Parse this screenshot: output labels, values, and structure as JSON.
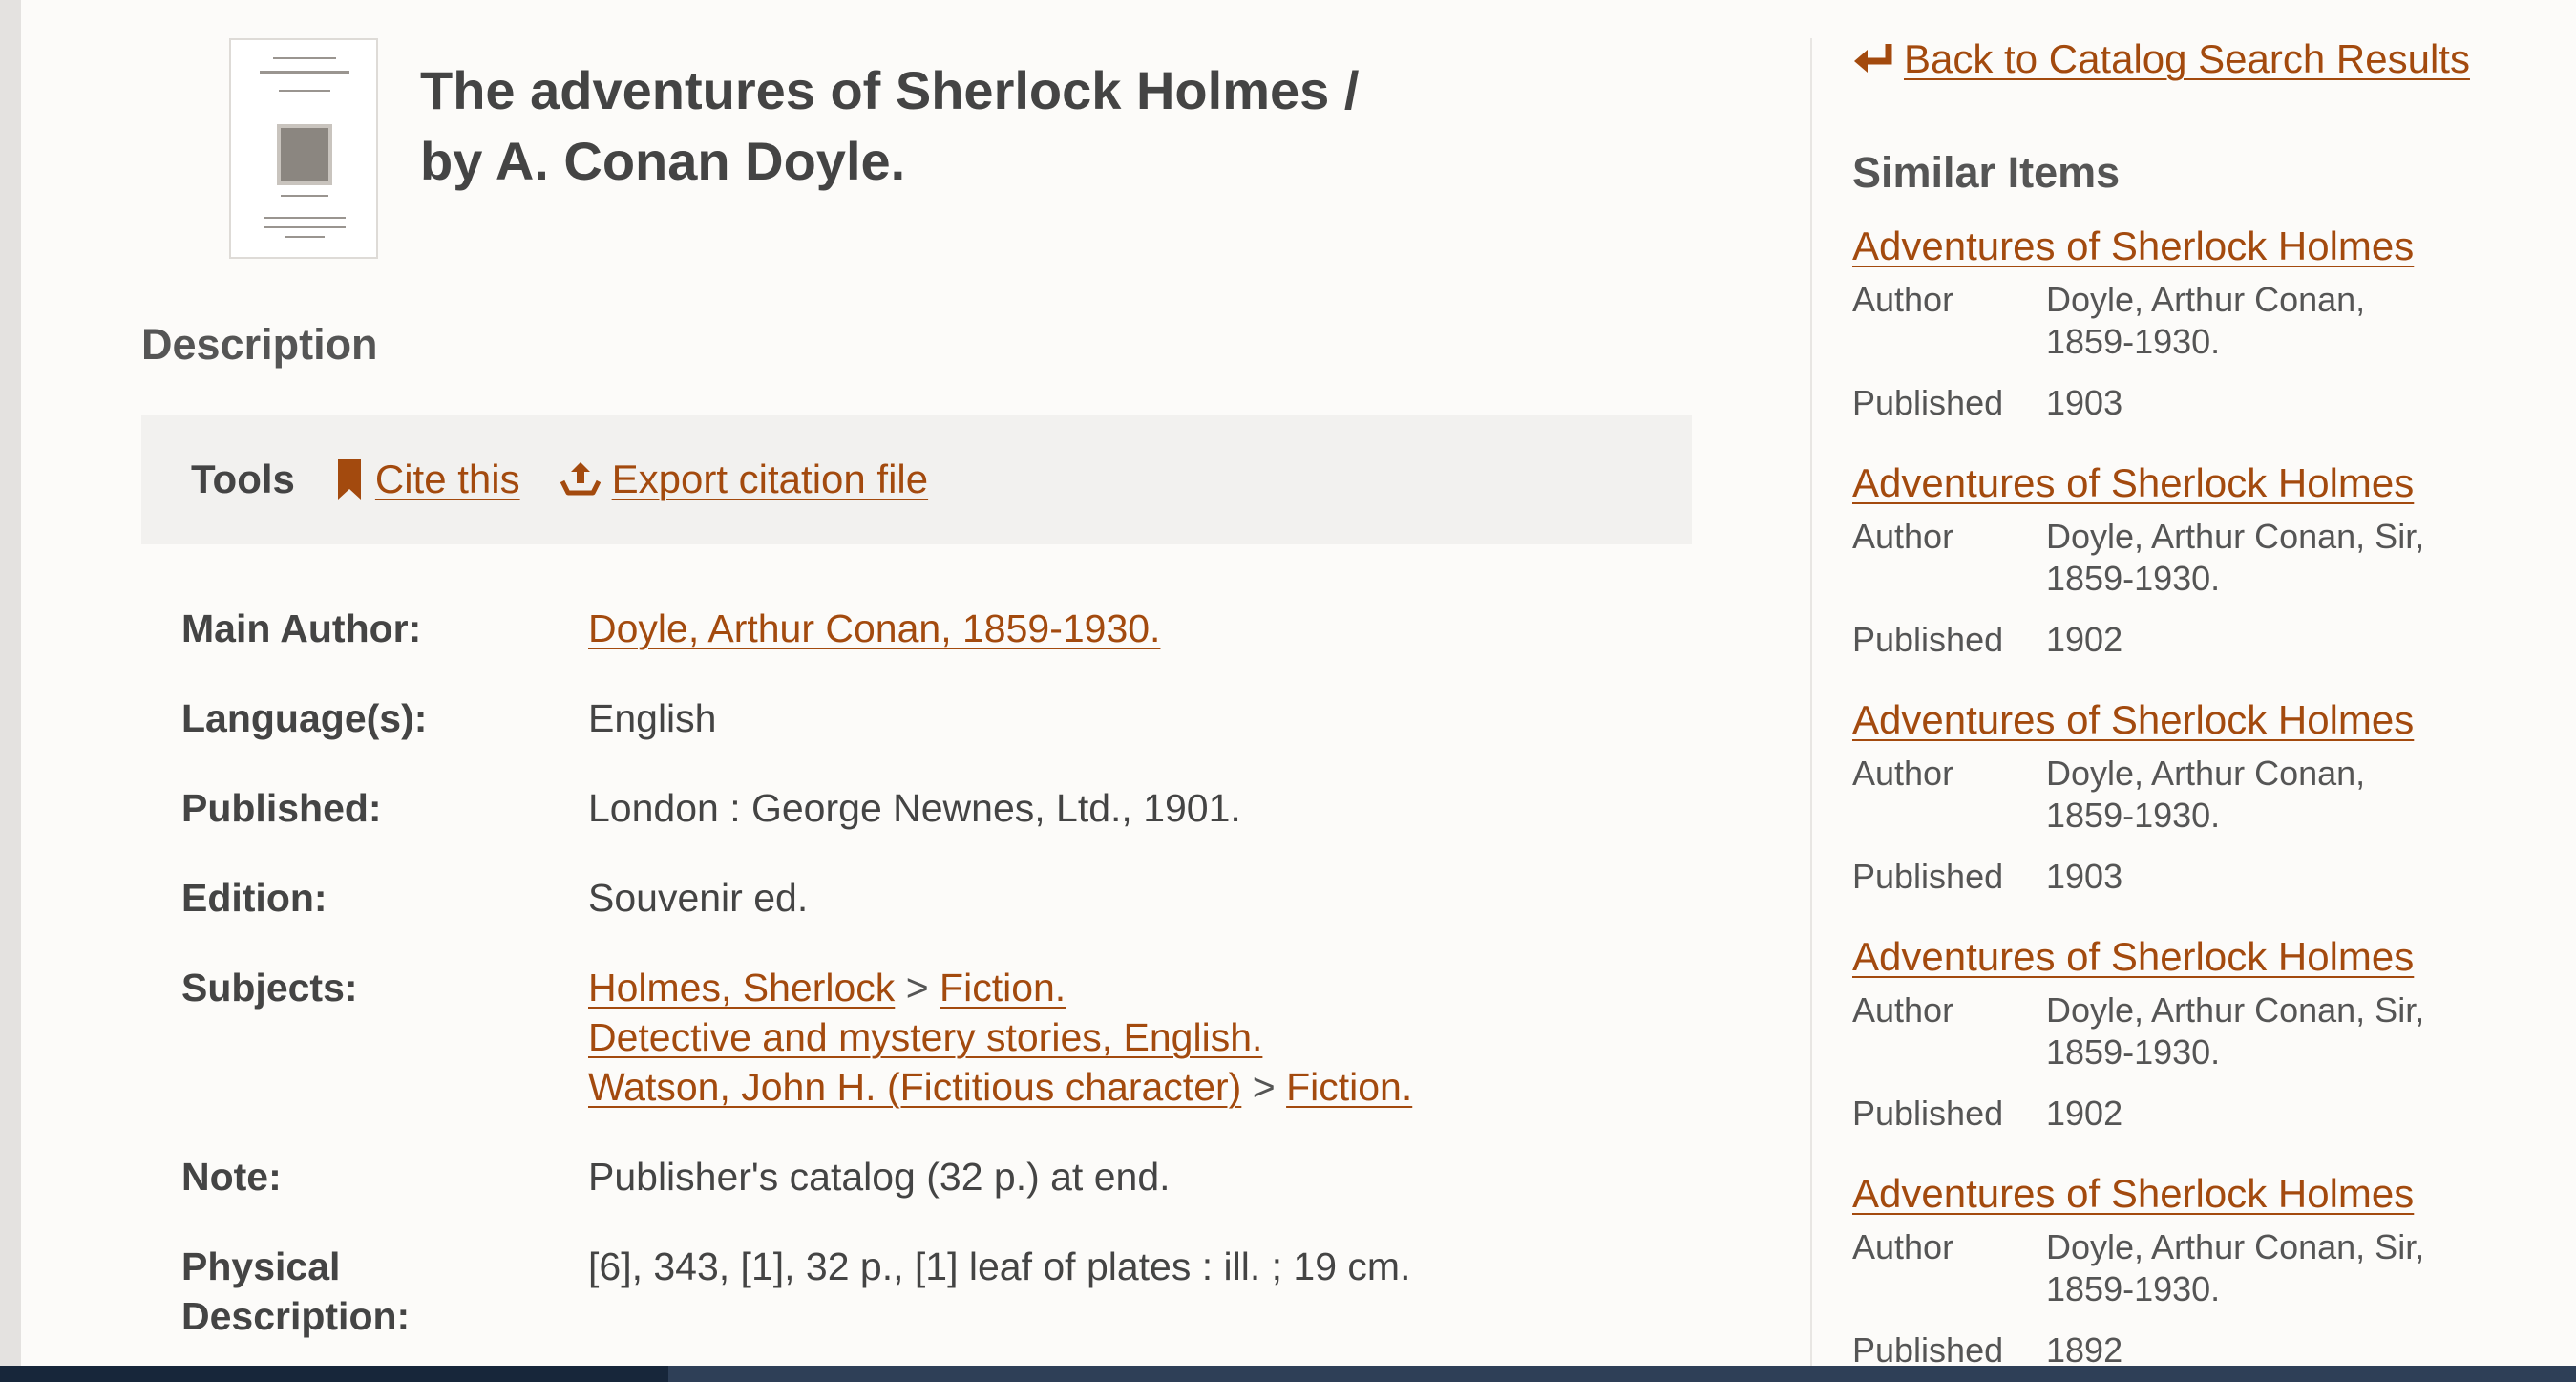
{
  "record": {
    "title_line1": "The adventures of Sherlock Holmes /",
    "title_line2": "by A. Conan Doyle.",
    "section_heading": "Description"
  },
  "tools": {
    "label": "Tools",
    "cite_label": "Cite this",
    "cite_icon": "bookmark-icon",
    "export_label": "Export citation file",
    "export_icon": "export-icon"
  },
  "details": {
    "main_author_label": "Main Author:",
    "main_author_value": "Doyle, Arthur Conan, 1859-1930.",
    "language_label": "Language(s):",
    "language_value": "English",
    "published_label": "Published:",
    "published_value": "London : George Newnes, Ltd., 1901.",
    "edition_label": "Edition:",
    "edition_value": "Souvenir ed.",
    "subjects_label": "Subjects:",
    "subjects": [
      {
        "parts": [
          "Holmes, Sherlock",
          "Fiction."
        ]
      },
      {
        "parts": [
          "Detective and mystery stories, English."
        ]
      },
      {
        "parts": [
          "Watson, John H. (Fictitious character)",
          "Fiction."
        ]
      }
    ],
    "subject_separator": ">",
    "note_label": "Note:",
    "note_value": "Publisher's catalog (32 p.) at end.",
    "physical_label_1": "Physical",
    "physical_label_2": "Description:",
    "physical_value": "[6], 343, [1], 32 p., [1] leaf of plates : ill. ; 19 cm."
  },
  "sidebar": {
    "back_label": "Back to Catalog Search Results",
    "back_icon": "return-arrow-icon",
    "similar_heading": "Similar Items",
    "author_key": "Author",
    "published_key": "Published",
    "items": [
      {
        "title": "Adventures of Sherlock Holmes",
        "author_1": "Doyle, Arthur Conan,",
        "author_2": "1859-1930.",
        "published": "1903"
      },
      {
        "title": "Adventures of Sherlock Holmes",
        "author_1": "Doyle, Arthur Conan, Sir,",
        "author_2": "1859-1930.",
        "published": "1902"
      },
      {
        "title": "Adventures of Sherlock Holmes",
        "author_1": "Doyle, Arthur Conan,",
        "author_2": "1859-1930.",
        "published": "1903"
      },
      {
        "title": "Adventures of Sherlock Holmes",
        "author_1": "Doyle, Arthur Conan, Sir,",
        "author_2": "1859-1930.",
        "published": "1902"
      },
      {
        "title": "Adventures of Sherlock Holmes",
        "author_1": "Doyle, Arthur Conan, Sir,",
        "author_2": "1859-1930.",
        "published": "1892"
      }
    ]
  },
  "colors": {
    "link": "#a34a0e",
    "background": "#fcfbf9",
    "tools_background": "#f2f1ef"
  }
}
